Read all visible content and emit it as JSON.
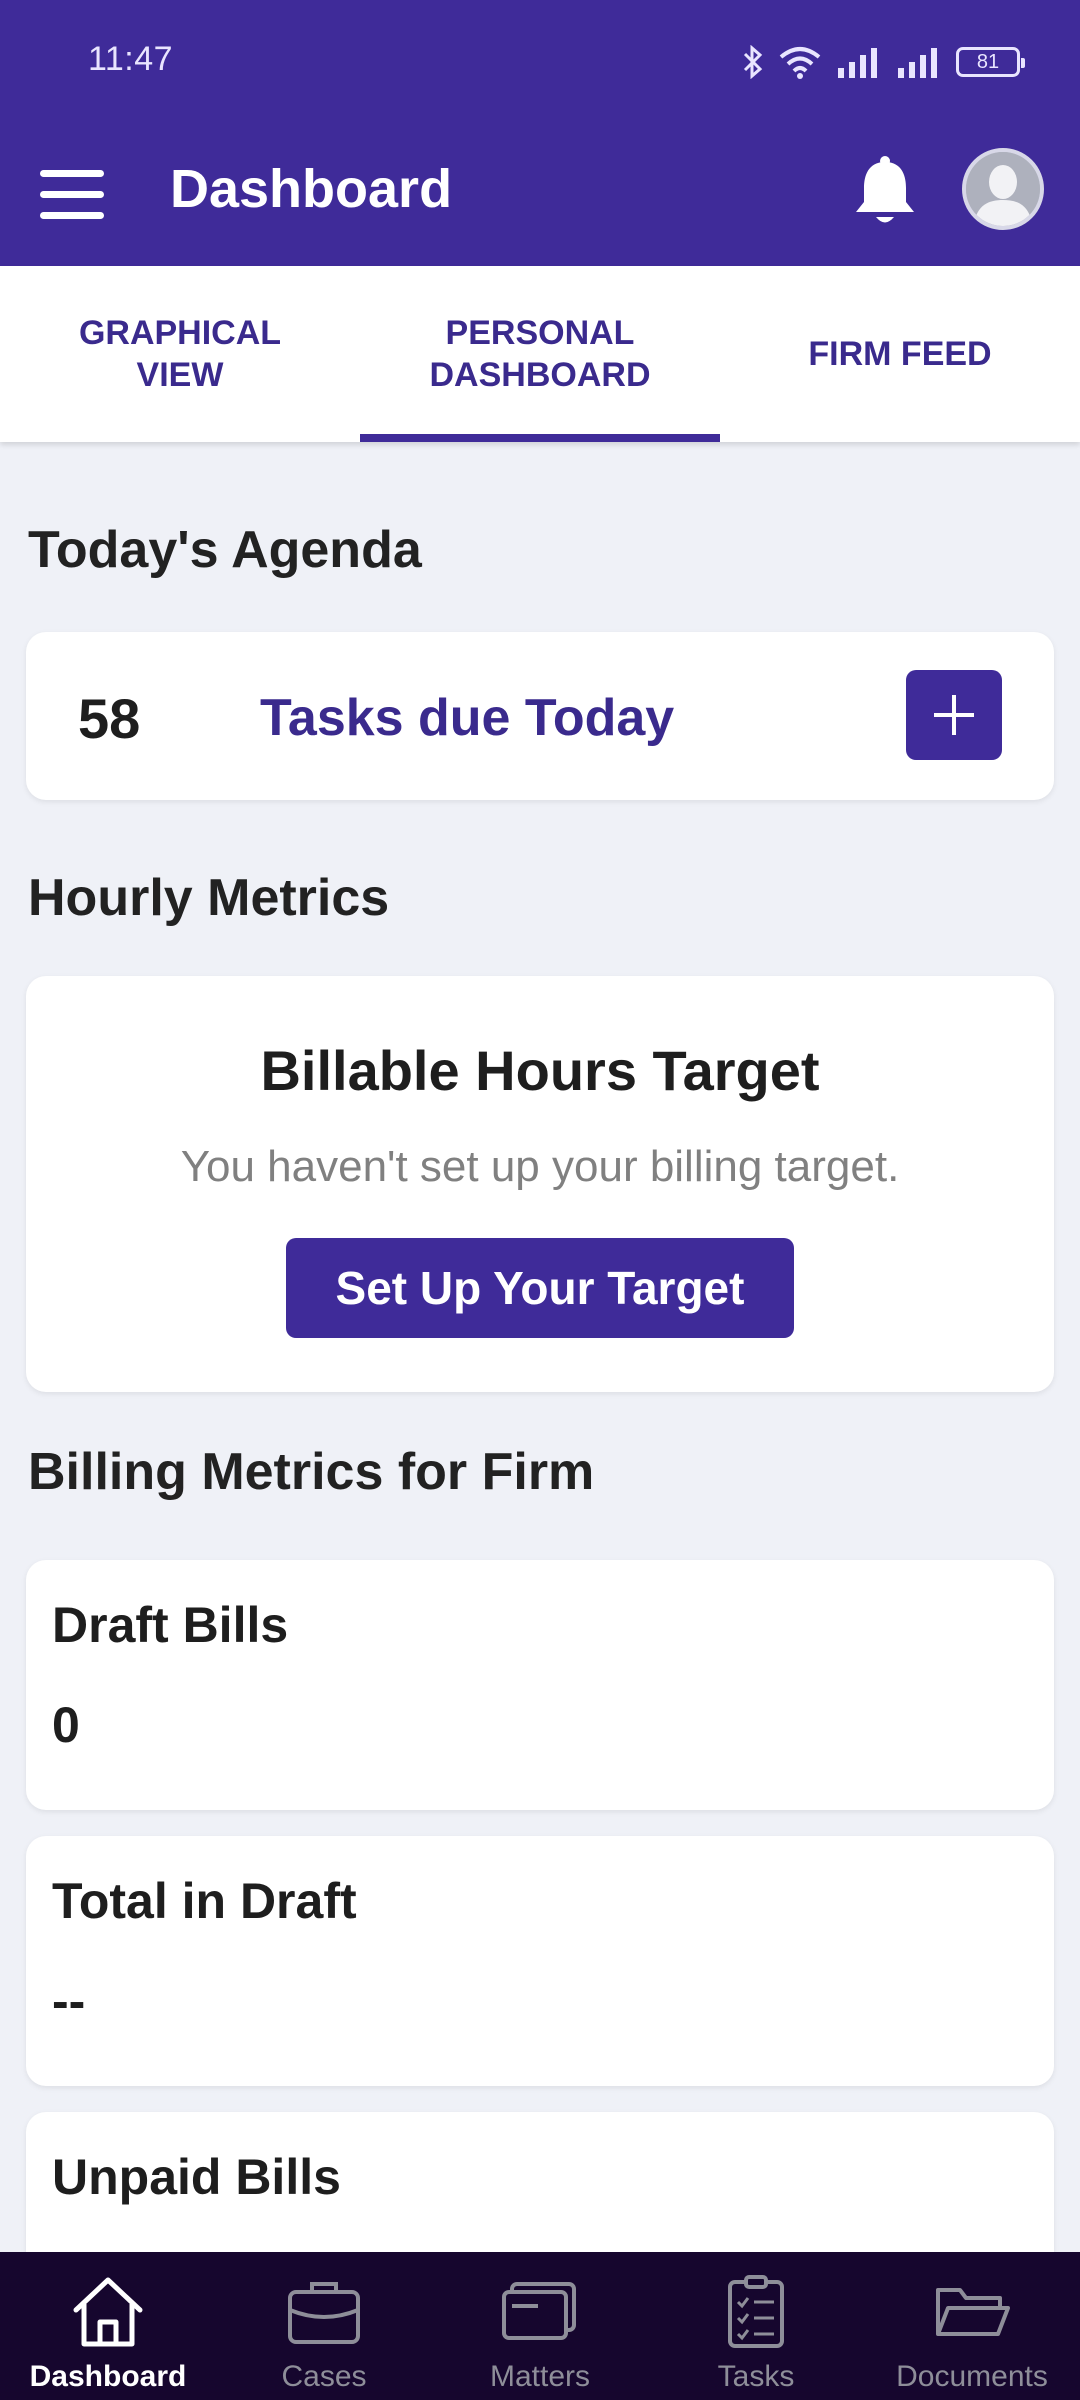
{
  "status_bar": {
    "time": "11:47",
    "battery": "81",
    "icons": [
      "bluetooth-icon",
      "wifi-icon",
      "signal-icon",
      "signal-icon",
      "battery-icon"
    ]
  },
  "header": {
    "title": "Dashboard",
    "icons": [
      "menu-icon",
      "bell-icon",
      "avatar-icon"
    ]
  },
  "tabs": [
    {
      "label": "Graphical View",
      "active": false
    },
    {
      "label": "Personal Dashboard",
      "active": true
    },
    {
      "label": "Firm Feed",
      "active": false
    }
  ],
  "agenda": {
    "section_title": "Today's Agenda",
    "count": "58",
    "label": "Tasks due Today",
    "add_icon": "plus-icon"
  },
  "hourly": {
    "section_title": "Hourly Metrics",
    "card_title": "Billable Hours Target",
    "subtitle": "You haven't set up your billing target.",
    "button_label": "Set Up Your Target"
  },
  "billing": {
    "section_title": "Billing Metrics for Firm",
    "metrics": [
      {
        "label": "Draft Bills",
        "value": "0"
      },
      {
        "label": "Total in Draft",
        "value": "--"
      },
      {
        "label": "Unpaid Bills",
        "value": ""
      }
    ]
  },
  "bottom_nav": [
    {
      "label": "Dashboard",
      "icon": "home-icon",
      "active": true
    },
    {
      "label": "Cases",
      "icon": "briefcase-icon",
      "active": false
    },
    {
      "label": "Matters",
      "icon": "card-icon",
      "active": false
    },
    {
      "label": "Tasks",
      "icon": "clipboard-icon",
      "active": false
    },
    {
      "label": "Documents",
      "icon": "folder-icon",
      "active": false
    }
  ],
  "colors": {
    "primary": "#3f2b99",
    "background": "#eff1f7",
    "nav_background": "#16062e"
  }
}
